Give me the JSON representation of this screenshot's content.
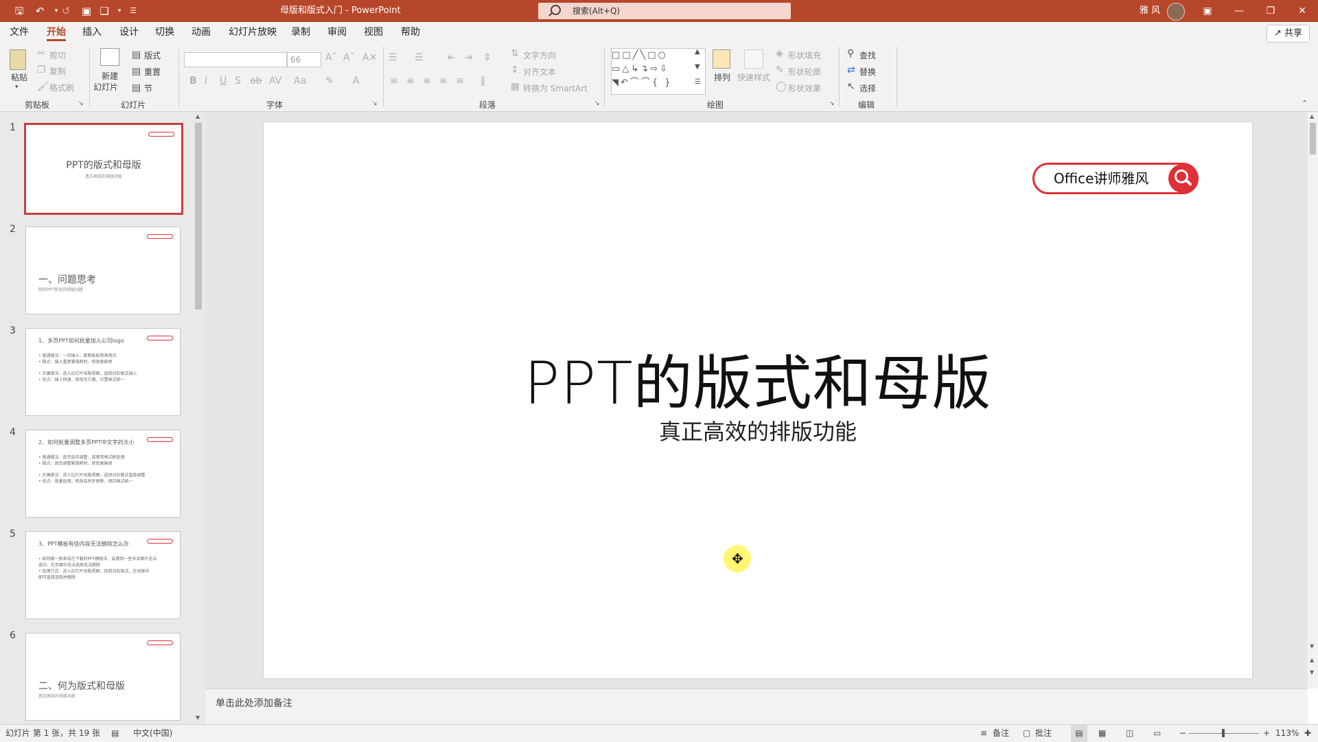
{
  "app": {
    "document_title": "母版和版式入门 - PowerPoint",
    "search_placeholder": "搜索(Alt+Q)",
    "user_name": "雅 风",
    "share_label": "共享"
  },
  "menu": {
    "tabs": [
      "文件",
      "开始",
      "插入",
      "设计",
      "切换",
      "动画",
      "幻灯片放映",
      "录制",
      "审阅",
      "视图",
      "帮助"
    ],
    "active_tab": "开始"
  },
  "ribbon": {
    "clipboard": {
      "group": "剪贴板",
      "paste": "粘贴",
      "cut": "剪切",
      "copy": "复制",
      "format_painter": "格式刷"
    },
    "slides": {
      "group": "幻灯片",
      "new_slide_line1": "新建",
      "new_slide_line2": "幻灯片",
      "layout": "版式",
      "reset": "重置",
      "section": "节"
    },
    "font": {
      "group": "字体",
      "font_name": "",
      "font_size": "66"
    },
    "paragraph": {
      "group": "段落",
      "text_direction": "文字方向",
      "align_text": "对齐文本",
      "smartart": "转换为 SmartArt"
    },
    "drawing": {
      "group": "绘图",
      "arrange": "排列",
      "quick_styles": "快速样式",
      "shape_fill": "形状填充",
      "shape_outline": "形状轮廓",
      "shape_effects": "形状效果"
    },
    "editing": {
      "group": "编辑",
      "find": "查找",
      "replace": "替换",
      "select": "选择"
    }
  },
  "thumbnails": [
    {
      "num": "1",
      "title": "PPT的版式和母版",
      "subtitle": "真正高效的排版功能",
      "lines": []
    },
    {
      "num": "2",
      "title": "一、问题思考",
      "subtitle": "制作PPT常见的排版问题",
      "lines": []
    },
    {
      "num": "3",
      "title": "1、多页PPT如何批量加入公司logo",
      "subtitle": "",
      "lines": [
        "• 普通做法：一页插入，复制粘贴到其他页",
        "• 缺点：插入重复繁琐耗时，修改更麻烦",
        "• 正确做法：进入幻灯片母版视图，选择对应版式插入",
        "• 优点：插入快速，修改也方便，位置格式统一"
      ]
    },
    {
      "num": "4",
      "title": "2、如何批量调整多页PPT中文字的大小",
      "subtitle": "",
      "lines": [
        "• 普通做法：逐页选中调整，或者用格式刷处理",
        "• 缺点：逐页调整繁琐耗时，修改更麻烦",
        "• 正确做法：进入幻灯片母版视图，选择对应版式直接调整",
        "• 优点：批量处理，修改会同步更新，保持格式统一"
      ]
    },
    {
      "num": "5",
      "title": "3、PPT模板有些内容无法删除怎么办",
      "subtitle": "",
      "lines": [
        "• 如何做一般来说在下载的PPT模板中，会遇到一些多余图片无法",
        "  选中，在页面中无法选取无法删除",
        "• 处理方式：进入幻灯片母版视图，找到对应版式，在母版中",
        "  即可直接选取并删除"
      ]
    },
    {
      "num": "6",
      "title": "二、何为版式和母版",
      "subtitle": "真正高效的排版功能",
      "lines": []
    }
  ],
  "slide": {
    "badge_text": "Office讲师雅风",
    "title": "PPT的版式和母版",
    "subtitle": "真正高效的排版功能"
  },
  "notes_placeholder": "单击此处添加备注",
  "status": {
    "slide_info": "幻灯片 第 1 张，共 19 张",
    "language": "中文(中国)",
    "notes": "备注",
    "comments": "批注",
    "zoom": "113%"
  },
  "colors": {
    "accent": "#b7472a",
    "badge_red": "#e02f37",
    "thumb_selected": "#c9403a"
  }
}
